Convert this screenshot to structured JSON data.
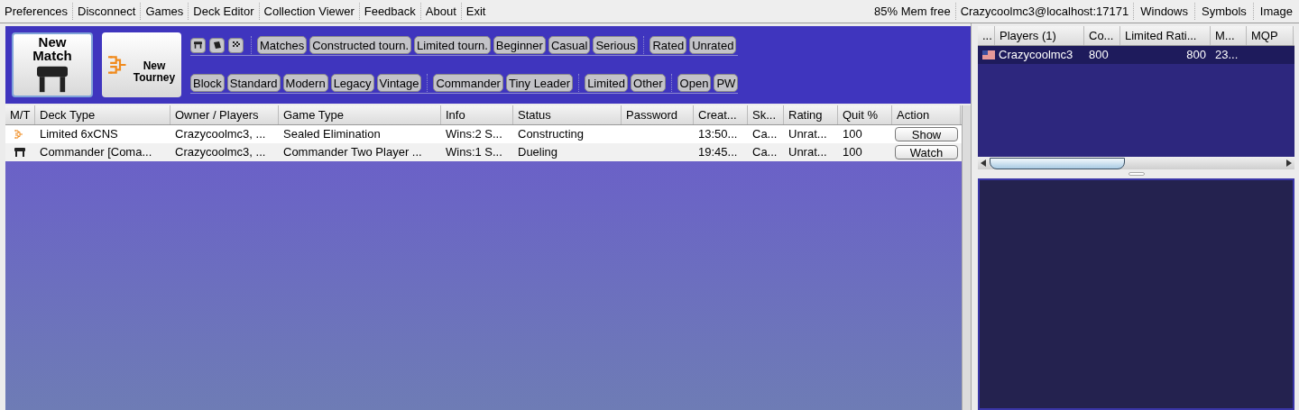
{
  "menu_bar": {
    "items": [
      "Preferences",
      "Disconnect",
      "Games",
      "Deck Editor",
      "Collection Viewer",
      "Feedback",
      "About",
      "Exit"
    ],
    "memory": "85% Mem free",
    "connection": "Crazycoolmc3@localhost:17171",
    "right_items": [
      "Windows",
      "Symbols",
      "Image"
    ]
  },
  "toolbar": {
    "new_match": {
      "line_1": "New",
      "line_2": "Match"
    },
    "new_tourney": {
      "line_1": "New",
      "line_2": "Tourney"
    },
    "filter_rows": [
      {
        "groups": [
          [
            "Matches",
            "Constructed tourn.",
            "Limited tourn.",
            "Beginner",
            "Casual",
            "Serious"
          ],
          [
            "Rated",
            "Unrated"
          ]
        ]
      },
      {
        "groups": [
          [
            "Block",
            "Standard",
            "Modern",
            "Legacy",
            "Vintage"
          ],
          [
            "Commander",
            "Tiny Leader"
          ],
          [
            "Limited",
            "Other"
          ],
          [
            "Open",
            "PW"
          ]
        ]
      }
    ]
  },
  "games_table": {
    "columns": [
      "M/T",
      "Deck Type",
      "Owner / Players",
      "Game Type",
      "Info",
      "Status",
      "Password",
      "Creat...",
      "Sk...",
      "Rating",
      "Quit %",
      "Action"
    ],
    "rows": [
      {
        "kind": "tourney",
        "deck_type": "Limited 6xCNS",
        "owner": "Crazycoolmc3, ...",
        "game_type": "Sealed Elimination",
        "info": "Wins:2 S...",
        "status": "Constructing",
        "password": "",
        "created": "13:50...",
        "skill": "Ca...",
        "rating": "Unrat...",
        "quit": "100",
        "action": "Show"
      },
      {
        "kind": "match",
        "deck_type": "Commander [Coma...",
        "owner": "Crazycoolmc3, ...",
        "game_type": "Commander Two Player ...",
        "info": "Wins:1 S...",
        "status": "Dueling",
        "password": "",
        "created": "19:45...",
        "skill": "Ca...",
        "rating": "Unrat...",
        "quit": "100",
        "action": "Watch"
      }
    ]
  },
  "players_table": {
    "columns": [
      "...",
      "Players (1)",
      "Co...",
      "Limited Rati...",
      "M...",
      "MQP"
    ],
    "rows": [
      {
        "name": "Crazycoolmc3",
        "constructed": "800",
        "limited": "800",
        "matches": "23...",
        "mqp": "",
        "selected": true
      }
    ]
  }
}
